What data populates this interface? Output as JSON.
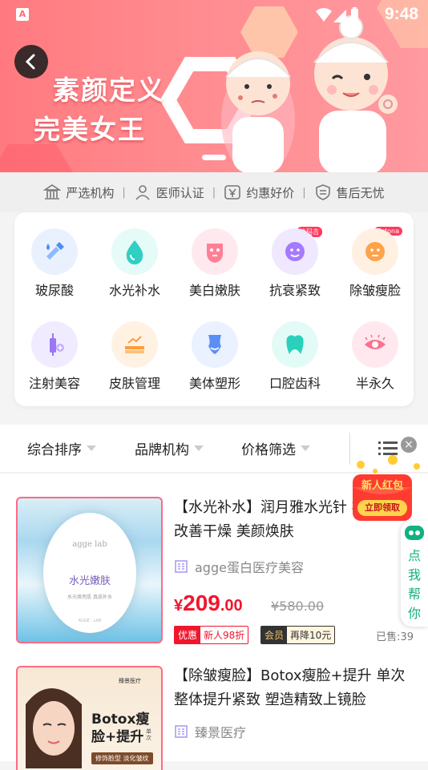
{
  "status_bar": {
    "app_icon": "A",
    "time": "9:48"
  },
  "banner": {
    "line1": "素颜定义",
    "line2": "完美女王"
  },
  "guarantees": [
    {
      "label": "严选机构",
      "icon": "institution-icon"
    },
    {
      "label": "医师认证",
      "icon": "doctor-icon"
    },
    {
      "label": "约惠好价",
      "icon": "yen-icon"
    },
    {
      "label": "售后无忧",
      "icon": "shield-icon"
    }
  ],
  "categories": [
    {
      "label": "玻尿酸",
      "icon": "dropper-icon",
      "bg": "#e9f1ff",
      "color": "#4d8ff2"
    },
    {
      "label": "水光补水",
      "icon": "water-drop-icon",
      "bg": "#e4fbf8",
      "color": "#2fcfc4"
    },
    {
      "label": "美白嫩肤",
      "icon": "face-mask-icon",
      "bg": "#ffe9ee",
      "color": "#ff7f96"
    },
    {
      "label": "抗衰紧致",
      "icon": "face-lift-icon",
      "bg": "#f0e8ff",
      "color": "#a47aff",
      "tag": "热玛吉"
    },
    {
      "label": "除皱瘦脸",
      "icon": "face-slim-icon",
      "bg": "#fff0e2",
      "color": "#ffa24a",
      "tag": "Fotona"
    },
    {
      "label": "注射美容",
      "icon": "syringe-icon",
      "bg": "#f1ebff",
      "color": "#9b76f7"
    },
    {
      "label": "皮肤管理",
      "icon": "skin-layers-icon",
      "bg": "#fff2e3",
      "color": "#ff9c3b"
    },
    {
      "label": "美体塑形",
      "icon": "body-shape-icon",
      "bg": "#eaf1ff",
      "color": "#5b8ff7"
    },
    {
      "label": "口腔齿科",
      "icon": "tooth-icon",
      "bg": "#e3fbf7",
      "color": "#2ad0bb"
    },
    {
      "label": "半永久",
      "icon": "eye-icon",
      "bg": "#ffe9ef",
      "color": "#ff6f8e"
    }
  ],
  "filters": [
    {
      "label": "综合排序"
    },
    {
      "label": "品牌机构"
    },
    {
      "label": "价格筛选"
    }
  ],
  "items": [
    {
      "title": "【水光补水】润月雅水光针 补水保湿 改善干燥 美颜焕肤",
      "shop": "agge蛋白医疗美容",
      "price_symbol": "¥",
      "price_int": "209",
      "price_dec": ".00",
      "old_price": "¥580.00",
      "badge1_left": "优惠",
      "badge1_right": "新人98折",
      "badge2_left": "会员",
      "badge2_right": "再降10元",
      "sold": "已售:39",
      "thumb_logo": "agge lab",
      "thumb_title": "水光嫩肤",
      "thumb_sub": "水光焕亮肌  真皮补水",
      "thumb_foot": "AGGE · LAB"
    },
    {
      "title": "【除皱瘦脸】Botox瘦脸+提升 单次 整体提升紧致 塑造精致上镜脸",
      "shop": "臻景医疗",
      "thumb_brand": "臻景医疗",
      "thumb_line1": "Botox瘦",
      "thumb_line2": "脸+提升",
      "thumb_unit": "单次",
      "thumb_bar": "修饰脸型 淡化皱纹"
    }
  ],
  "red_packet": {
    "title": "新人红包",
    "button": "立即领取"
  },
  "helper": {
    "chars": [
      "点",
      "我",
      "帮",
      "你"
    ]
  }
}
